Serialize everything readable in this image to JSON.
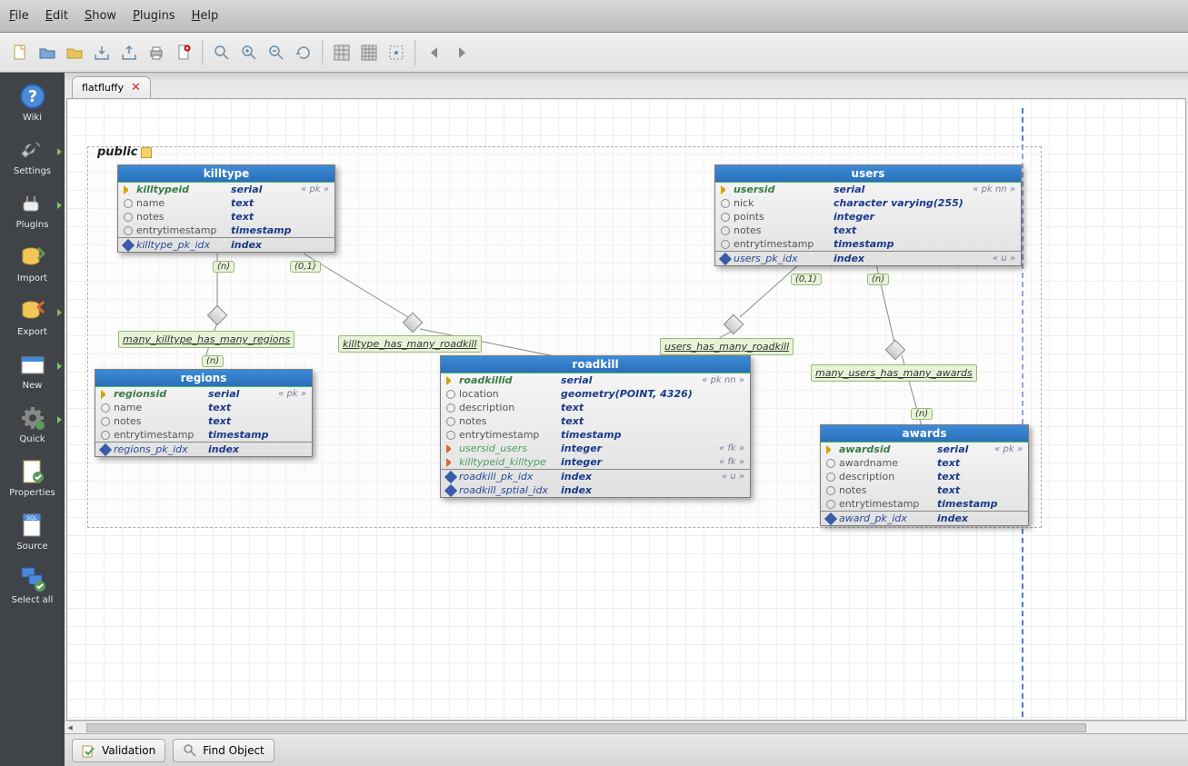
{
  "menubar": [
    "File",
    "Edit",
    "Show",
    "Plugins",
    "Help"
  ],
  "sidebar": [
    {
      "label": "Wiki"
    },
    {
      "label": "Settings",
      "arrow": true
    },
    {
      "label": "Plugins",
      "arrow": true
    },
    {
      "label": "Import"
    },
    {
      "label": "Export",
      "arrow": true
    },
    {
      "label": "New",
      "arrow": true
    },
    {
      "label": "Quick",
      "arrow": true
    },
    {
      "label": "Properties"
    },
    {
      "label": "Source"
    },
    {
      "label": "Select all"
    }
  ],
  "tab": {
    "title": "flatfluffy"
  },
  "schema": {
    "name": "public"
  },
  "tables": {
    "killtype": {
      "title": "killtype",
      "cols": [
        {
          "name": "killtypeid",
          "type": "serial",
          "extra": "« pk »",
          "k": "pk"
        },
        {
          "name": "name",
          "type": "text",
          "k": "nc"
        },
        {
          "name": "notes",
          "type": "text",
          "k": "nc"
        },
        {
          "name": "entrytimestamp",
          "type": "timestamp",
          "k": "nc"
        }
      ],
      "idx": [
        {
          "name": "killtype_pk_idx",
          "type": "index"
        }
      ]
    },
    "users": {
      "title": "users",
      "cols": [
        {
          "name": "usersid",
          "type": "serial",
          "extra": "« pk nn »",
          "k": "pk"
        },
        {
          "name": "nick",
          "type": "character varying(255)",
          "k": "nc"
        },
        {
          "name": "points",
          "type": "integer",
          "k": "nc"
        },
        {
          "name": "notes",
          "type": "text",
          "k": "nc"
        },
        {
          "name": "entrytimestamp",
          "type": "timestamp",
          "k": "nc"
        }
      ],
      "idx": [
        {
          "name": "users_pk_idx",
          "type": "index",
          "extra": "« u »"
        }
      ]
    },
    "regions": {
      "title": "regions",
      "cols": [
        {
          "name": "regionsid",
          "type": "serial",
          "extra": "« pk »",
          "k": "pk"
        },
        {
          "name": "name",
          "type": "text",
          "k": "nc"
        },
        {
          "name": "notes",
          "type": "text",
          "k": "nc"
        },
        {
          "name": "entrytimestamp",
          "type": "timestamp",
          "k": "nc"
        }
      ],
      "idx": [
        {
          "name": "regions_pk_idx",
          "type": "index"
        }
      ]
    },
    "roadkill": {
      "title": "roadkill",
      "cols": [
        {
          "name": "roadkillid",
          "type": "serial",
          "extra": "« pk nn »",
          "k": "pk"
        },
        {
          "name": "location",
          "type": "geometry(POINT, 4326)",
          "k": "nc"
        },
        {
          "name": "description",
          "type": "text",
          "k": "nc"
        },
        {
          "name": "notes",
          "type": "text",
          "k": "nc"
        },
        {
          "name": "entrytimestamp",
          "type": "timestamp",
          "k": "nc"
        },
        {
          "name": "usersid_users",
          "type": "integer",
          "extra": "« fk »",
          "k": "fk"
        },
        {
          "name": "killtypeid_killtype",
          "type": "integer",
          "extra": "« fk »",
          "k": "fk"
        }
      ],
      "idx": [
        {
          "name": "roadkill_pk_idx",
          "type": "index",
          "extra": "« u »"
        },
        {
          "name": "roadkill_sptial_idx",
          "type": "index"
        }
      ]
    },
    "awards": {
      "title": "awards",
      "cols": [
        {
          "name": "awardsid",
          "type": "serial",
          "extra": "« pk »",
          "k": "pk"
        },
        {
          "name": "awardname",
          "type": "text",
          "k": "nc"
        },
        {
          "name": "description",
          "type": "text",
          "k": "nc"
        },
        {
          "name": "notes",
          "type": "text",
          "k": "nc"
        },
        {
          "name": "entrytimestamp",
          "type": "timestamp",
          "k": "nc"
        }
      ],
      "idx": [
        {
          "name": "award_pk_idx",
          "type": "index"
        }
      ]
    }
  },
  "rels": {
    "r1": {
      "label": "many_killtype_has_many_regions"
    },
    "r2": {
      "label": "killtype_has_many_roadkill"
    },
    "r3": {
      "label": "users_has_many_roadkill"
    },
    "r4": {
      "label": "many_users_has_many_awards"
    }
  },
  "cards": {
    "n": "(n)",
    "zo": "(0,1)"
  },
  "bottom": {
    "validation": "Validation",
    "find": "Find Object"
  }
}
